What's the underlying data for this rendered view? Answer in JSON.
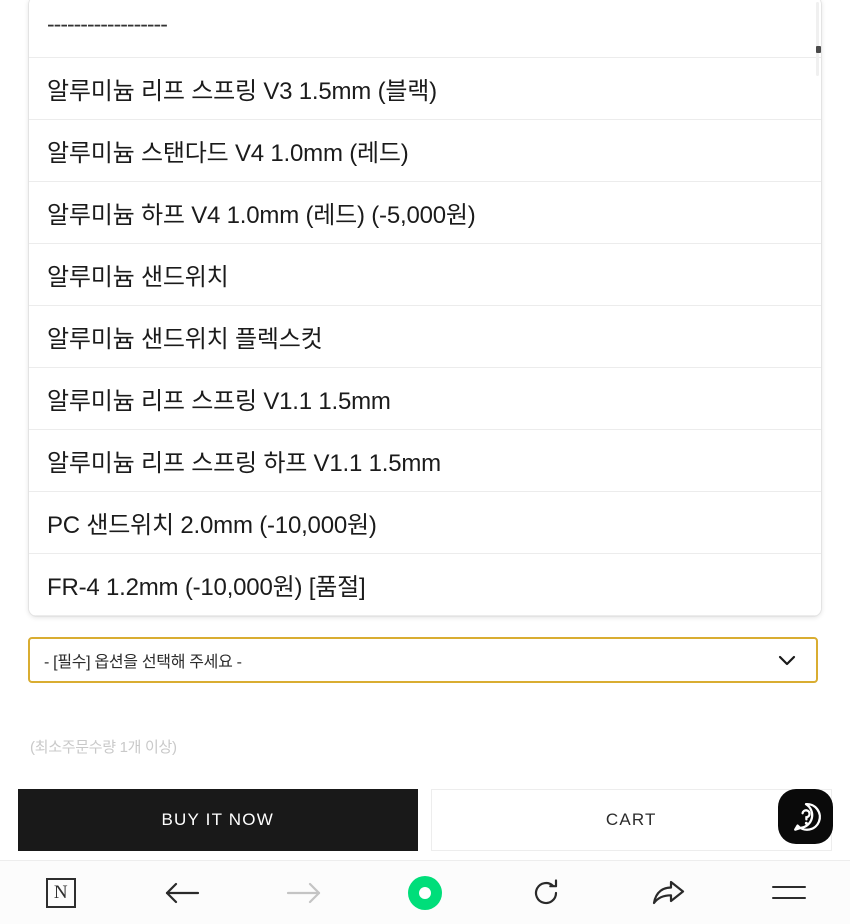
{
  "dropdown": {
    "options": [
      {
        "label": "------------------",
        "type": "separator"
      },
      {
        "label": "알루미늄 리프 스프링 V3 1.5mm (블랙)",
        "type": "option"
      },
      {
        "label": "알루미늄 스탠다드 V4 1.0mm (레드)",
        "type": "option"
      },
      {
        "label": "알루미늄 하프 V4 1.0mm (레드) (-5,000원)",
        "type": "option"
      },
      {
        "label": "알루미늄 샌드위치",
        "type": "option"
      },
      {
        "label": "알루미늄 샌드위치 플렉스컷",
        "type": "option"
      },
      {
        "label": "알루미늄 리프 스프링 V1.1 1.5mm",
        "type": "option"
      },
      {
        "label": "알루미늄 리프 스프링 하프 V1.1 1.5mm",
        "type": "option"
      },
      {
        "label": "PC 샌드위치 2.0mm (-10,000원)",
        "type": "option"
      },
      {
        "label": "FR-4 1.2mm (-10,000원) [품절]",
        "type": "option"
      }
    ]
  },
  "select": {
    "value": "- [필수] 옵션을 선택해 주세요 -",
    "placeholder": "- [필수] 옵션을 선택해 주세요 -",
    "border_color": "#d9ad31",
    "chevron_icon": "chevron-down-icon"
  },
  "notice": {
    "min_quantity": "(최소주문수량 1개 이상)"
  },
  "actions": {
    "buy_label": "BUY IT NOW",
    "cart_label": "CART",
    "buy_bg": "#191919"
  },
  "help": {
    "icon": "question-bubble-icon"
  },
  "browser_bar": {
    "tools": [
      {
        "name": "naver-logo",
        "glyph": "N"
      },
      {
        "name": "back-arrow-icon",
        "glyph": "←"
      },
      {
        "name": "forward-arrow-icon",
        "glyph": "→"
      },
      {
        "name": "naver-home-icon",
        "glyph": "●"
      },
      {
        "name": "refresh-icon",
        "glyph": "⟳"
      },
      {
        "name": "share-icon",
        "glyph": "↪"
      },
      {
        "name": "menu-icon",
        "glyph": "≡"
      }
    ],
    "accent_green": "#00de7a"
  }
}
